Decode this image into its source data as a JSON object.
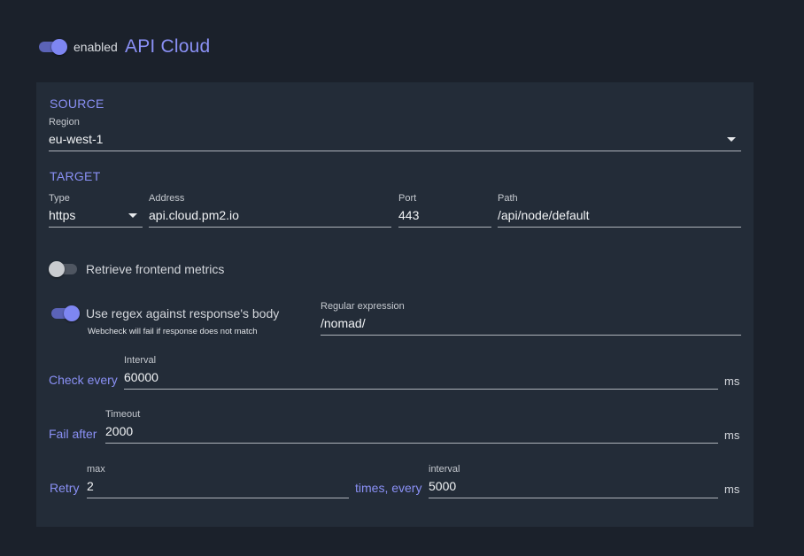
{
  "header": {
    "enabled_label": "enabled",
    "title": "API Cloud",
    "enabled": true
  },
  "source": {
    "section_title": "SOURCE",
    "region_label": "Region",
    "region_value": "eu-west-1"
  },
  "target": {
    "section_title": "TARGET",
    "type_label": "Type",
    "type_value": "https",
    "address_label": "Address",
    "address_value": "api.cloud.pm2.io",
    "port_label": "Port",
    "port_value": "443",
    "path_label": "Path",
    "path_value": "/api/node/default"
  },
  "frontend_metrics": {
    "label": "Retrieve frontend metrics",
    "enabled": false
  },
  "regex": {
    "label": "Use regex against response's body",
    "hint": "Webcheck will fail if response does not match",
    "enabled": true,
    "field_label": "Regular expression",
    "field_value": "/nomad/"
  },
  "check_every": {
    "label": "Check every",
    "field_label": "Interval",
    "value": "60000",
    "unit": "ms"
  },
  "fail_after": {
    "label": "Fail after",
    "field_label": "Timeout",
    "value": "2000",
    "unit": "ms"
  },
  "retry": {
    "label": "Retry",
    "max_label": "max",
    "max_value": "2",
    "middle_label": "times, every",
    "interval_label": "interval",
    "interval_value": "5000",
    "unit": "ms"
  },
  "colors": {
    "accent": "#8a90f5",
    "background": "#1b212b",
    "panel": "#232c38"
  }
}
